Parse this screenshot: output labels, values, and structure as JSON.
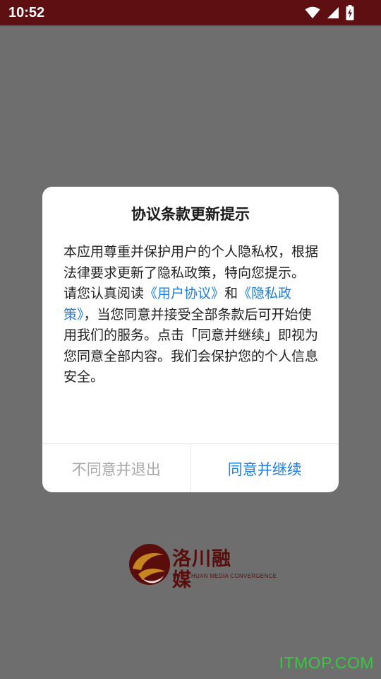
{
  "status_bar": {
    "time": "10:52",
    "icons": [
      "wifi-icon",
      "cell-signal-icon",
      "battery-charging-icon"
    ]
  },
  "dialog": {
    "title": "协议条款更新提示",
    "paragraph1": "本应用尊重并保护用户的个人隐私权，根据法律要求更新了隐私政策，特向您提示。",
    "paragraph2_prefix": "请您认真阅读",
    "user_agreement_link": "《用户协议》",
    "conjunction": "和",
    "privacy_policy_link": "《隐私政策》",
    "paragraph2_suffix": "，当您同意并接受全部条款后可开始使用我们的服务。点击「同意并继续」即视为您同意全部内容。我们会保护您的个人信息安全。",
    "disagree_button": "不同意并退出",
    "agree_button": "同意并继续"
  },
  "logo": {
    "name_cn": "洛川融媒",
    "name_en": "LUO CHUAN MEDIA CONVERGENCE"
  },
  "watermark": "ITMOP.COM",
  "colors": {
    "status_bar": "#5e0f12",
    "overlay": "#6e6e6e",
    "link": "#1e7fe0",
    "disabled_text": "#a6a6a6",
    "logo": "#5a0e0c",
    "logo_accent": "#c8841f",
    "watermark": "#34c93f"
  }
}
